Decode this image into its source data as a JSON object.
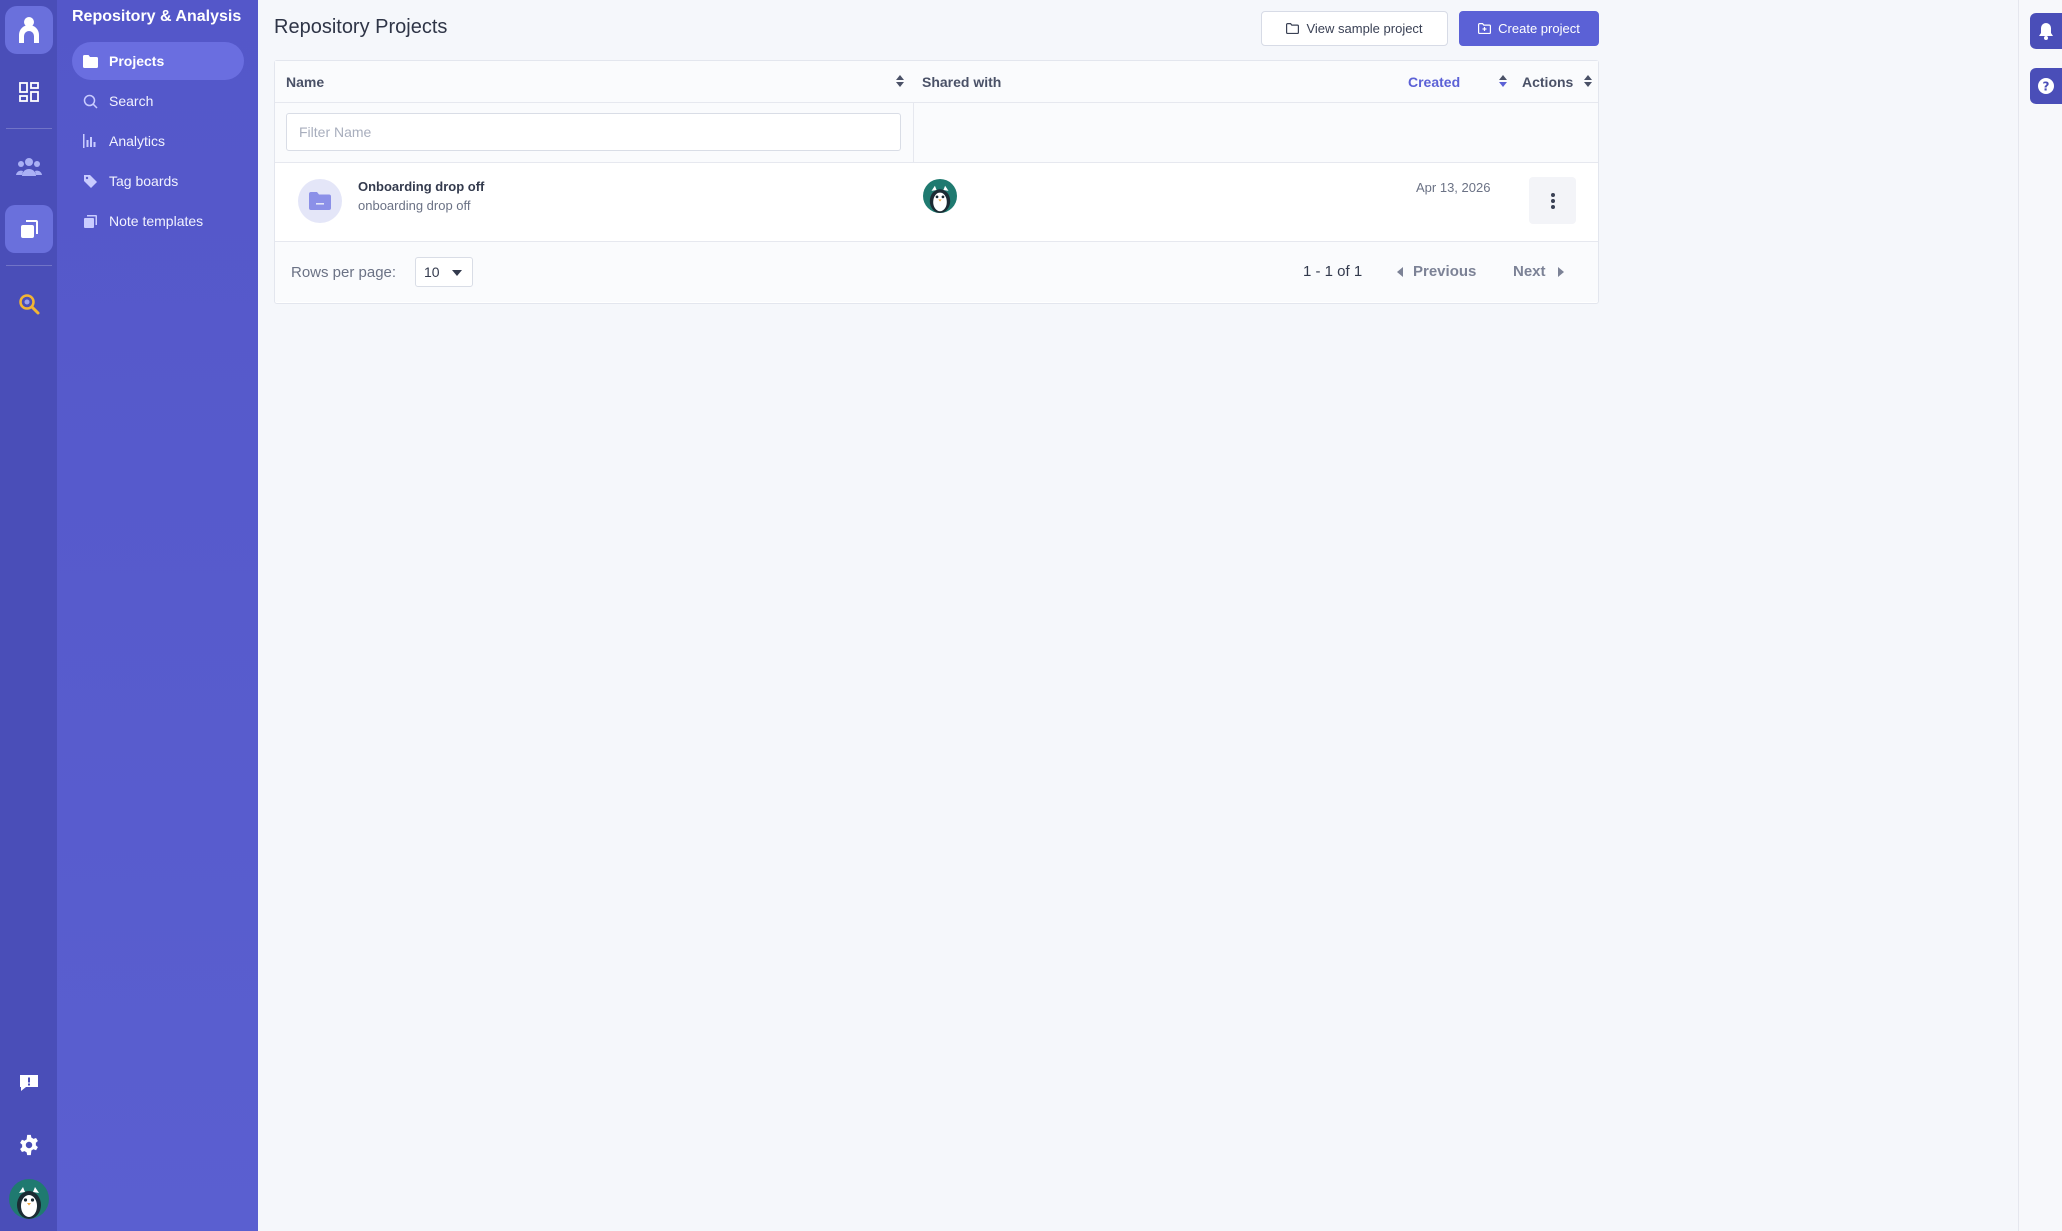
{
  "sidebar": {
    "title": "Repository & Analysis",
    "items": [
      {
        "label": "Projects",
        "icon": "folder-icon"
      },
      {
        "label": "Search",
        "icon": "search-icon"
      },
      {
        "label": "Analytics",
        "icon": "bar-chart-icon"
      },
      {
        "label": "Tag boards",
        "icon": "tag-icon"
      },
      {
        "label": "Note templates",
        "icon": "template-icon"
      }
    ]
  },
  "header": {
    "title": "Repository Projects",
    "view_sample_label": "View sample project",
    "create_label": "Create project"
  },
  "table": {
    "columns": {
      "name": "Name",
      "shared": "Shared with",
      "created": "Created",
      "actions": "Actions"
    },
    "filter_placeholder": "Filter Name",
    "rows": [
      {
        "name": "Onboarding drop off",
        "description": "onboarding drop off",
        "created": "Apr 13, 2026"
      }
    ]
  },
  "pagination": {
    "rows_per_page_label": "Rows per page:",
    "rows_per_page_value": "10",
    "range": "1 - 1 of 1",
    "previous": "Previous",
    "next": "Next"
  },
  "colors": {
    "rail": "#4a4eb8",
    "sidebar": "#5457c9",
    "accent": "#5b61d6"
  }
}
